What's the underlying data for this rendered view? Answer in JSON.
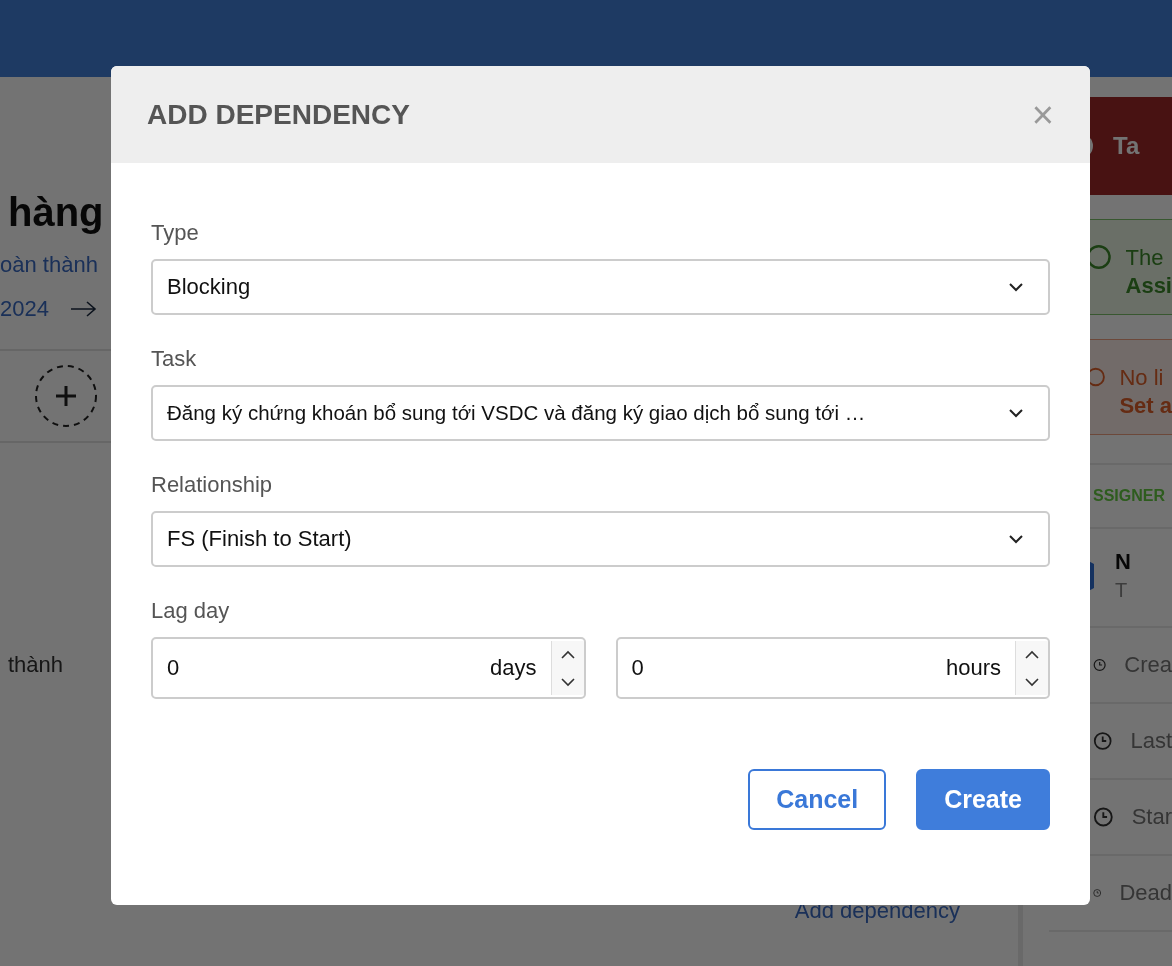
{
  "background_page": {
    "title_fragment": "hàng",
    "status_fragment": "oàn thành",
    "date_fragment": "2024",
    "body_fragment": "thành",
    "add_dependency_link": "Add dependency"
  },
  "side_panel": {
    "alert": "Ta",
    "success_notice": {
      "line_1": "The",
      "line_2": "Assi"
    },
    "warning_notice": {
      "line_1": "No li",
      "line_2": "Set a"
    },
    "section_heading": "SSIGNER",
    "assignee": {
      "name": "N",
      "role": "T"
    },
    "info_rows": [
      "Crea",
      "Last",
      "Star",
      "Dead"
    ]
  },
  "dialog": {
    "title": "ADD DEPENDENCY",
    "close": "×",
    "fields": [
      {
        "kind": "select",
        "label": "Type",
        "value": "Blocking"
      },
      {
        "kind": "select",
        "label": "Task",
        "value": "Đăng ký chứng khoán bổ sung tới VSDC và đăng ký giao dịch bổ sung tới …"
      },
      {
        "kind": "select",
        "label": "Relationship",
        "value": "FS (Finish to Start)"
      },
      {
        "kind": "number_pair",
        "label": "Lag day",
        "inputs": [
          {
            "value": "0",
            "unit": "days"
          },
          {
            "value": "0",
            "unit": "hours"
          }
        ]
      }
    ],
    "buttons": [
      {
        "label": "Cancel",
        "kind": "secondary"
      },
      {
        "label": "Create",
        "kind": "primary"
      }
    ]
  }
}
